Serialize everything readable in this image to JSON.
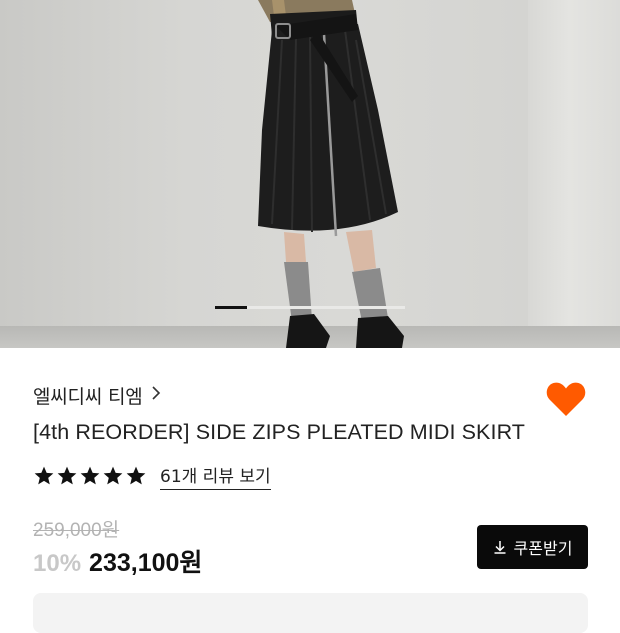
{
  "product": {
    "brand": "엘씨디씨 티엠",
    "title": "[4th REORDER] SIDE ZIPS PLEATED MIDI SKIRT",
    "rating_stars": 5,
    "review_link": "61개 리뷰 보기",
    "original_price": "259,000원",
    "discount": "10%",
    "sale_price": "233,100원",
    "coupon_label": "쿠폰받기",
    "liked": true
  },
  "gallery": {
    "current_slide_fraction": 0.17
  },
  "colors": {
    "heart": "#ff5a00",
    "star": "#111111",
    "coupon_bg": "#0a0a0a",
    "discount": "#c8c8c8"
  },
  "icons": {
    "brand_chevron": "chevron-right-icon",
    "like": "heart-icon",
    "rating": "star-icon",
    "coupon": "download-icon"
  }
}
